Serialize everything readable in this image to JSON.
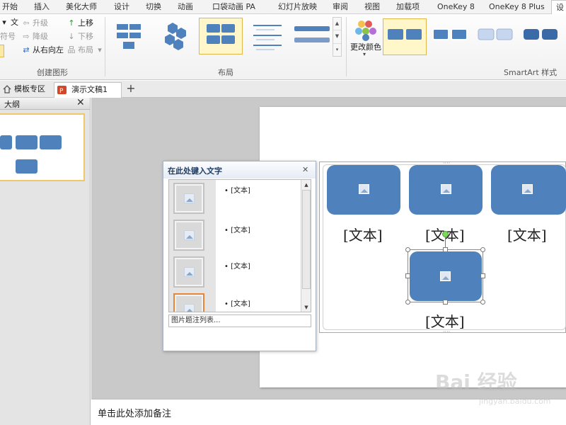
{
  "ribbon_tabs": [
    "开始",
    "插入",
    "美化大师",
    "设计",
    "切换",
    "动画",
    "口袋动画 PA",
    "幻灯片放映",
    "审阅",
    "视图",
    "加载项",
    "OneKey 8",
    "OneKey 8 Plus",
    "设"
  ],
  "create_graphic": {
    "partial_top": "文",
    "partial_middle": "符号",
    "promote": "升级",
    "demote": "降级",
    "right_to_left": "从右向左",
    "move_up": "上移",
    "move_down": "下移",
    "layout_btn": "布局",
    "group_label": "创建图形"
  },
  "layout_group": {
    "group_label": "布局"
  },
  "styles_group": {
    "change_colors": "更改颜色",
    "group_label": "SmartArt 样式"
  },
  "doc_tabs": {
    "templates": "模板专区",
    "document": "演示文稿1"
  },
  "outline_pane": {
    "title": "大纲"
  },
  "text_pane": {
    "title": "在此处键入文字",
    "items": [
      "[文本]",
      "[文本]",
      "[文本]",
      "[文本]"
    ],
    "footer": "图片题注列表..."
  },
  "smartart": {
    "captions": [
      "[文本]",
      "[文本]",
      "[文本]",
      "[文本]"
    ]
  },
  "notes": {
    "placeholder": "单击此处添加备注"
  },
  "watermark": {
    "brand": "Bai 经验",
    "url": "jingyan.baidu.com"
  },
  "colors": {
    "accent": "#4f81bd",
    "selection": "#e2b749",
    "active_thumb": "#e6863a"
  }
}
